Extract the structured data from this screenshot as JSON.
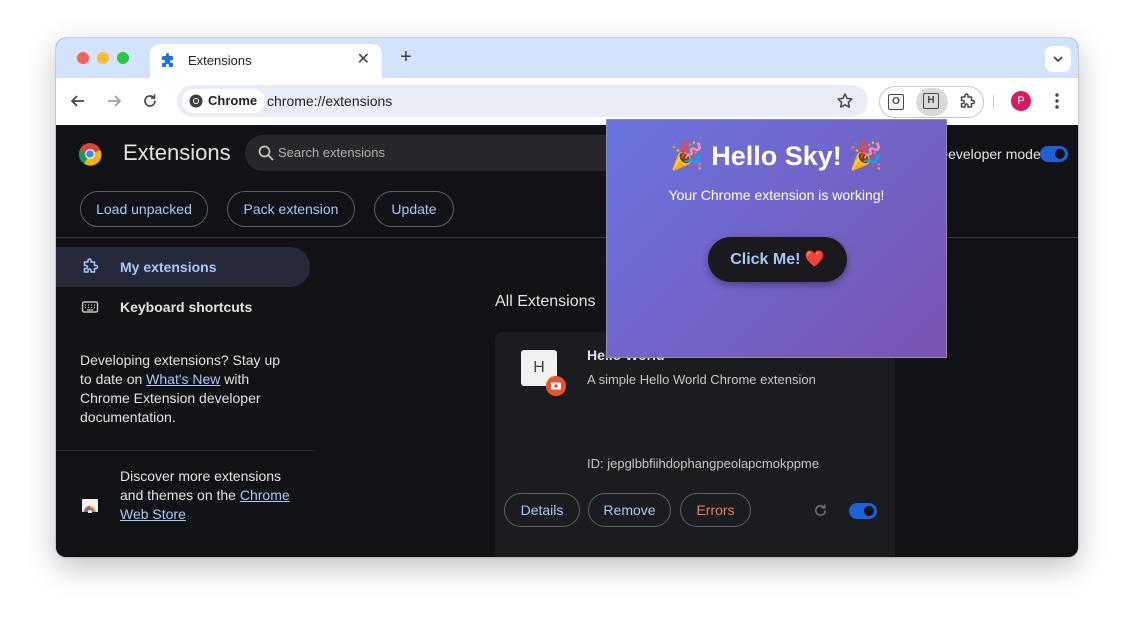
{
  "browser": {
    "tab": {
      "title": "Extensions",
      "close": "✕"
    },
    "new_tab": "+",
    "omnibox": {
      "chip_label": "Chrome",
      "url": "chrome://extensions"
    },
    "extensions_toolbar": {
      "ext1_letter": "O",
      "ext2_letter": "H"
    },
    "profile_initial": "P"
  },
  "header": {
    "title": "Extensions",
    "search_placeholder": "Search extensions",
    "developer_mode_label": "Developer mode",
    "buttons": {
      "load_unpacked": "Load unpacked",
      "pack_extension": "Pack extension",
      "update": "Update"
    }
  },
  "sidebar": {
    "items": [
      {
        "label": "My extensions",
        "icon": "extension-icon"
      },
      {
        "label": "Keyboard shortcuts",
        "icon": "keyboard-icon"
      }
    ],
    "dev_note": {
      "before": "Developing extensions? Stay up to date on ",
      "link": "What's New",
      "after": " with Chrome Extension developer documentation."
    },
    "webstore_note": {
      "before": "Discover more extensions and themes on the ",
      "link": "Chrome Web Store"
    }
  },
  "main": {
    "section_title": "All Extensions",
    "card": {
      "avatar_letter": "H",
      "name": "Hello World",
      "description": "A simple Hello World Chrome extension",
      "id_text": "ID: jepglbbfiihdophangpeolapcmokppme",
      "buttons": {
        "details": "Details",
        "remove": "Remove",
        "errors": "Errors"
      },
      "enabled": true
    }
  },
  "popup": {
    "title": "🎉 Hello Sky! 🎉",
    "subtitle": "Your Chrome extension is working!",
    "button": "Click Me! ❤️"
  },
  "colors": {
    "accent": "#a8c7fa",
    "toggle_on": "#1e60d8",
    "error": "#f07a5a",
    "popup_gradient_start": "#6a74e0",
    "popup_gradient_end": "#7a54b0"
  }
}
